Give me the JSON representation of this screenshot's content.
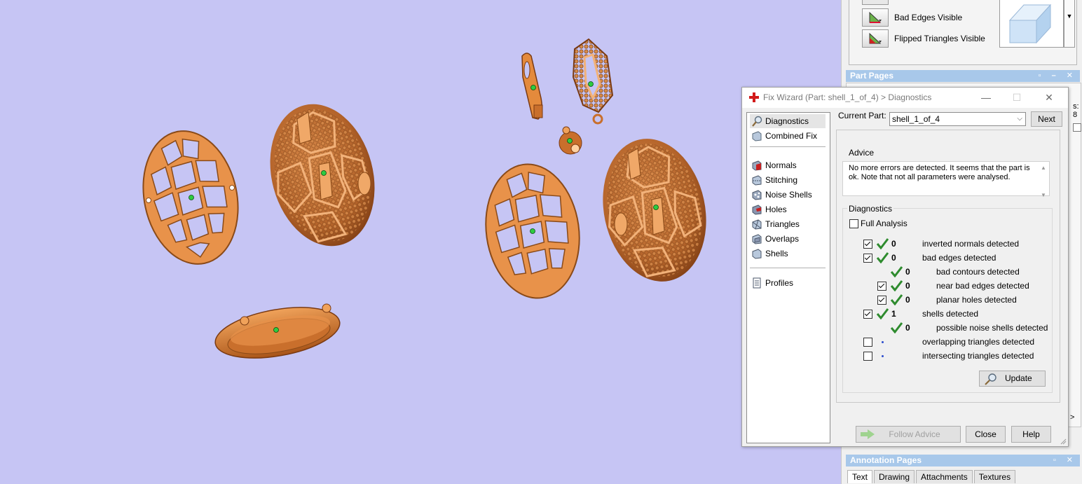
{
  "visibility_panel": {
    "items": [
      {
        "label": "Bad Edges Visible",
        "icon": "bad-edges-icon"
      },
      {
        "label": "Flipped Triangles Visible",
        "icon": "flipped-triangles-icon"
      }
    ]
  },
  "part_pages": {
    "title": "Part Pages",
    "peek_text": "s: 8"
  },
  "annotation_pages": {
    "title": "Annotation Pages",
    "tabs": [
      "Text",
      "Drawing",
      "Attachments",
      "Textures"
    ]
  },
  "fix_wizard": {
    "title": "Fix Wizard (Part: shell_1_of_4) > Diagnostics",
    "nav": {
      "top": [
        {
          "label": "Diagnostics",
          "icon": "magnifier-icon"
        },
        {
          "label": "Combined Fix",
          "icon": "combined-fix-icon"
        }
      ],
      "mid": [
        {
          "label": "Normals",
          "icon": "normals-icon"
        },
        {
          "label": "Stitching",
          "icon": "stitching-icon"
        },
        {
          "label": "Noise Shells",
          "icon": "noise-shells-icon"
        },
        {
          "label": "Holes",
          "icon": "holes-icon"
        },
        {
          "label": "Triangles",
          "icon": "triangles-icon"
        },
        {
          "label": "Overlaps",
          "icon": "overlaps-icon"
        },
        {
          "label": "Shells",
          "icon": "shells-icon"
        }
      ],
      "bottom": [
        {
          "label": "Profiles",
          "icon": "profiles-icon"
        }
      ]
    },
    "current_part_label": "Current Part:",
    "current_part_value": "shell_1_of_4",
    "next_label": "Next",
    "advice_title": "Advice",
    "advice_text": "No more errors are detected. It seems that the part is ok. Note that not all parameters were analysed.",
    "diagnostics_title": "Diagnostics",
    "full_analysis_label": "Full Analysis",
    "rows": [
      {
        "checkbox": true,
        "checked": true,
        "status": "ok",
        "count": "0",
        "label": "inverted normals detected",
        "indent": 0
      },
      {
        "checkbox": true,
        "checked": true,
        "status": "ok",
        "count": "0",
        "label": "bad edges detected",
        "indent": 0
      },
      {
        "checkbox": false,
        "checked": false,
        "status": "ok",
        "count": "0",
        "label": "bad contours detected",
        "indent": 1
      },
      {
        "checkbox": true,
        "checked": true,
        "status": "ok",
        "count": "0",
        "label": "near bad edges detected",
        "indent": 1
      },
      {
        "checkbox": true,
        "checked": true,
        "status": "ok",
        "count": "0",
        "label": "planar holes detected",
        "indent": 1
      },
      {
        "checkbox": true,
        "checked": true,
        "status": "ok",
        "count": "1",
        "label": "shells detected",
        "indent": 0
      },
      {
        "checkbox": false,
        "checked": false,
        "status": "ok",
        "count": "0",
        "label": "possible noise shells detected",
        "indent": 1
      },
      {
        "checkbox": true,
        "checked": false,
        "status": "pending",
        "count": "",
        "label": "overlapping triangles detected",
        "indent": 0
      },
      {
        "checkbox": true,
        "checked": false,
        "status": "pending",
        "count": "",
        "label": "intersecting triangles detected",
        "indent": 0
      }
    ],
    "update_label": "Update",
    "follow_advice_label": "Follow Advice",
    "close_label": "Close",
    "help_label": "Help"
  },
  "colors": {
    "viewport": "#c6c5f4",
    "model": "#e48a3c",
    "model_dark": "#a85418",
    "dock_header": "#a8c8ea",
    "check_green": "#2e8b2e",
    "pending_dot": "#2b4ccd"
  }
}
